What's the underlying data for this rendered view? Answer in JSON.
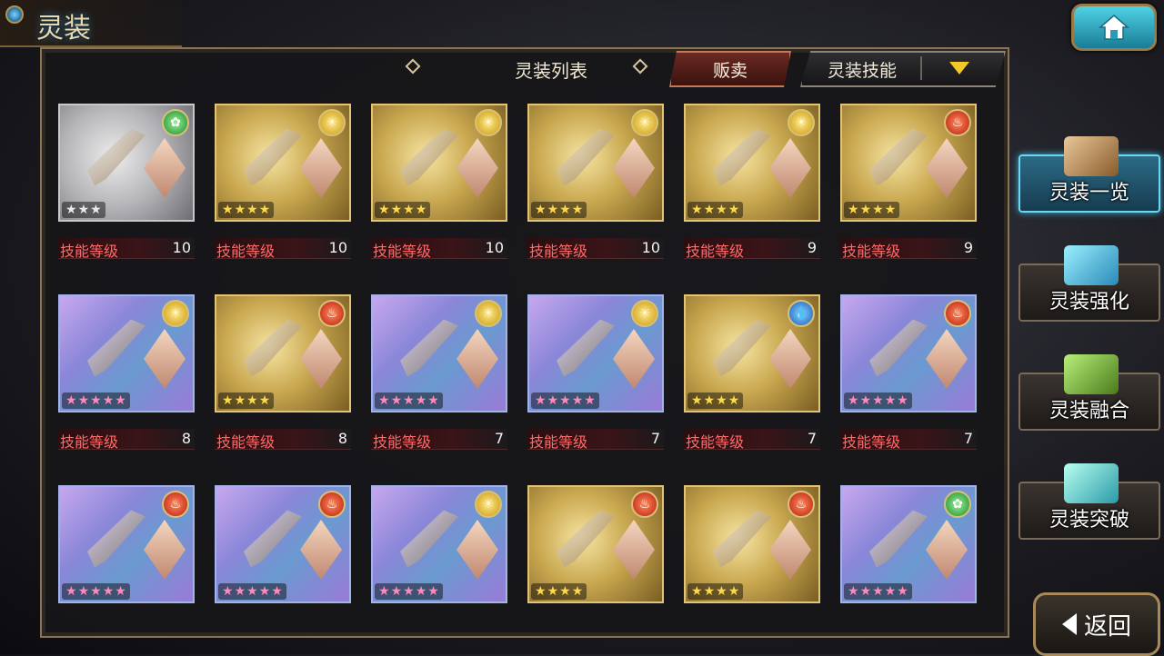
{
  "header": {
    "title": "灵装",
    "list_title": "灵装列表",
    "sell_label": "贩卖",
    "skill_filter_label": "灵装技能"
  },
  "cards": [
    {
      "frame": "silver",
      "element": "wind",
      "stars": 3,
      "level_label": "技能等级",
      "level": "10"
    },
    {
      "frame": "gold",
      "element": "sun",
      "stars": 4,
      "level_label": "技能等级",
      "level": "10"
    },
    {
      "frame": "gold",
      "element": "sun",
      "stars": 4,
      "level_label": "技能等级",
      "level": "10"
    },
    {
      "frame": "gold",
      "element": "sun",
      "stars": 4,
      "level_label": "技能等级",
      "level": "10"
    },
    {
      "frame": "gold",
      "element": "sun",
      "stars": 4,
      "level_label": "技能等级",
      "level": "9"
    },
    {
      "frame": "gold",
      "element": "fire",
      "stars": 4,
      "level_label": "技能等级",
      "level": "9"
    },
    {
      "frame": "rainbow",
      "element": "sun",
      "stars": 5,
      "level_label": "技能等级",
      "level": "8"
    },
    {
      "frame": "gold",
      "element": "fire",
      "stars": 4,
      "level_label": "技能等级",
      "level": "8"
    },
    {
      "frame": "rainbow",
      "element": "sun",
      "stars": 5,
      "level_label": "技能等级",
      "level": "7"
    },
    {
      "frame": "rainbow",
      "element": "sun",
      "stars": 5,
      "level_label": "技能等级",
      "level": "7"
    },
    {
      "frame": "gold",
      "element": "water",
      "stars": 4,
      "level_label": "技能等级",
      "level": "7"
    },
    {
      "frame": "rainbow",
      "element": "fire",
      "stars": 5,
      "level_label": "技能等级",
      "level": "7"
    },
    {
      "frame": "rainbow",
      "element": "fire",
      "stars": 5,
      "level_label": "",
      "level": ""
    },
    {
      "frame": "rainbow",
      "element": "fire",
      "stars": 5,
      "level_label": "",
      "level": ""
    },
    {
      "frame": "rainbow",
      "element": "sun",
      "stars": 5,
      "level_label": "",
      "level": ""
    },
    {
      "frame": "gold",
      "element": "fire",
      "stars": 4,
      "level_label": "",
      "level": ""
    },
    {
      "frame": "gold",
      "element": "fire",
      "stars": 4,
      "level_label": "",
      "level": ""
    },
    {
      "frame": "rainbow",
      "element": "wind",
      "stars": 5,
      "level_label": "",
      "level": ""
    }
  ],
  "side_menu": [
    {
      "label": "灵装一览",
      "active": true,
      "icon": "book-icon"
    },
    {
      "label": "灵装强化",
      "active": false,
      "icon": "crystal-icon"
    },
    {
      "label": "灵装融合",
      "active": false,
      "icon": "potion-icon"
    },
    {
      "label": "灵装突破",
      "active": false,
      "icon": "gem-icon"
    }
  ],
  "back_label": "返回",
  "colors": {
    "level_text": "#ff6a6a",
    "accent_active": "#3ab4d8",
    "sell_bg": "#6a2a22"
  }
}
